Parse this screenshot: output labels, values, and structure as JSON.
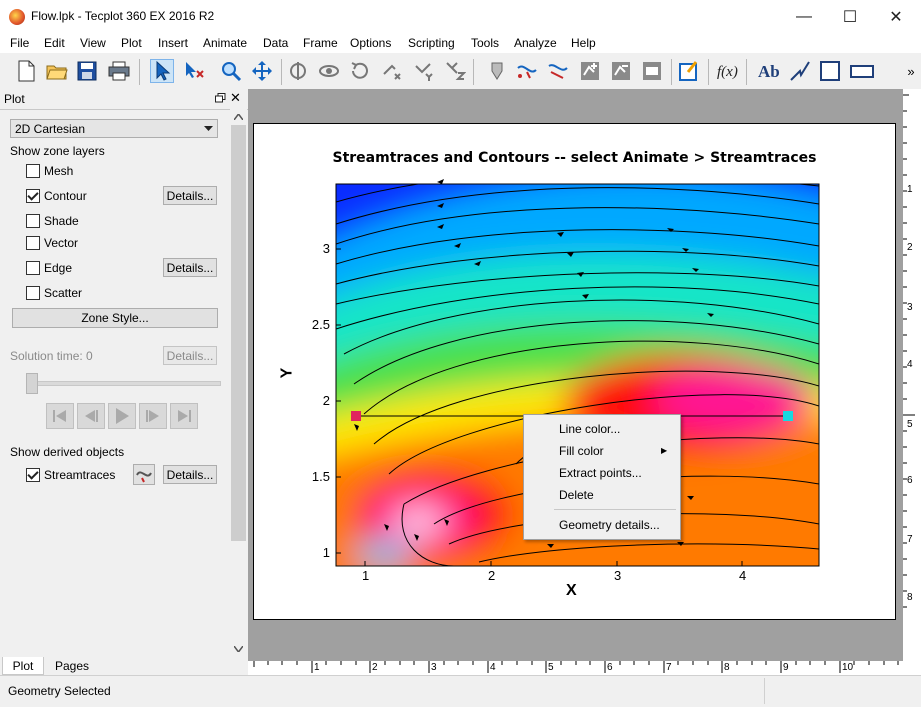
{
  "window": {
    "title": "Flow.lpk - Tecplot 360 EX 2016 R2",
    "minimize": "—",
    "maximize": "☐",
    "close": "✕"
  },
  "menu": [
    "File",
    "Edit",
    "View",
    "Plot",
    "Insert",
    "Animate",
    "Data",
    "Frame",
    "Options",
    "Scripting",
    "Tools",
    "Analyze",
    "Help"
  ],
  "toolbar": {
    "overflow": "»"
  },
  "sidebar": {
    "header": "Plot",
    "plot_type": "2D Cartesian",
    "zone_layers_label": "Show zone layers",
    "layers": [
      {
        "label": "Mesh",
        "checked": false
      },
      {
        "label": "Contour",
        "checked": true
      },
      {
        "label": "Shade",
        "checked": false
      },
      {
        "label": "Vector",
        "checked": false
      },
      {
        "label": "Edge",
        "checked": false
      },
      {
        "label": "Scatter",
        "checked": false
      }
    ],
    "details_label": "Details...",
    "zone_style_label": "Zone Style...",
    "solution_time_label": "Solution time:",
    "solution_time_value": "0",
    "derived_label": "Show derived objects",
    "streamtraces_label": "Streamtraces",
    "streamtraces_checked": true,
    "tabs": [
      "Plot",
      "Pages"
    ]
  },
  "plot": {
    "title": "Streamtraces and Contours -- select Animate > Streamtraces",
    "xlabel": "X",
    "ylabel": "Y",
    "x_ticks": [
      "1",
      "2",
      "3",
      "4"
    ],
    "y_ticks": [
      "1",
      "1.5",
      "2",
      "2.5",
      "3"
    ]
  },
  "context_menu": {
    "items": [
      "Line color...",
      "Fill color",
      "Extract points...",
      "Delete",
      "Geometry details..."
    ],
    "submenu_arrow": "▶"
  },
  "rulers": {
    "bottom": [
      "1",
      "2",
      "3",
      "4",
      "5",
      "6",
      "7",
      "8",
      "9",
      "10"
    ],
    "right": [
      "1",
      "2",
      "3",
      "4",
      "5",
      "6",
      "7",
      "8"
    ]
  },
  "status": "Geometry Selected",
  "colors": {
    "contour_high": "#ff1493",
    "contour_mid": "#ffff00",
    "contour_low": "#0000ff",
    "marker_start": "#e0245e",
    "marker_end": "#16d9e0"
  }
}
